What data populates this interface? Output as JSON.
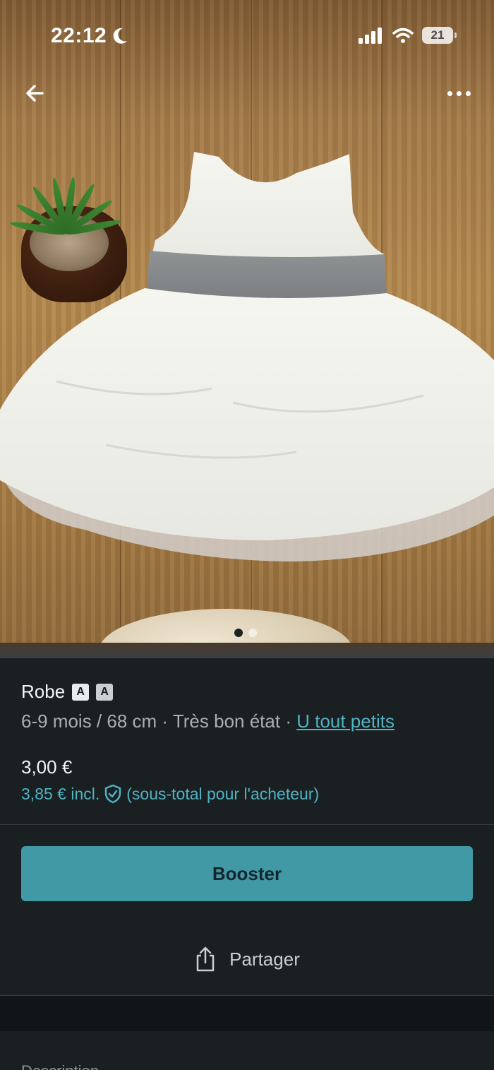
{
  "status_bar": {
    "time": "22:12",
    "battery": "21"
  },
  "navigation": {
    "back_icon": "arrow-left-icon",
    "more_icon": "more-horizontal-icon"
  },
  "photo": {
    "description_icon": "product-photo",
    "carousel_total": 2,
    "carousel_active_index": 0
  },
  "item": {
    "title": "Robe",
    "meta_size": "6-9 mois / 68 cm",
    "separator": "·",
    "condition": "Très bon état",
    "brand": "U tout petits",
    "price": "3,00 €",
    "price_incl": "3,85 € incl.",
    "price_incl_note": "(sous-total pour l'acheteur)"
  },
  "actions": {
    "boost_label": "Booster",
    "share_label": "Partager"
  },
  "description": {
    "label": "Description"
  },
  "colors": {
    "accent": "#4199a6",
    "link": "#4fb3c2",
    "background": "#1a1f22"
  }
}
